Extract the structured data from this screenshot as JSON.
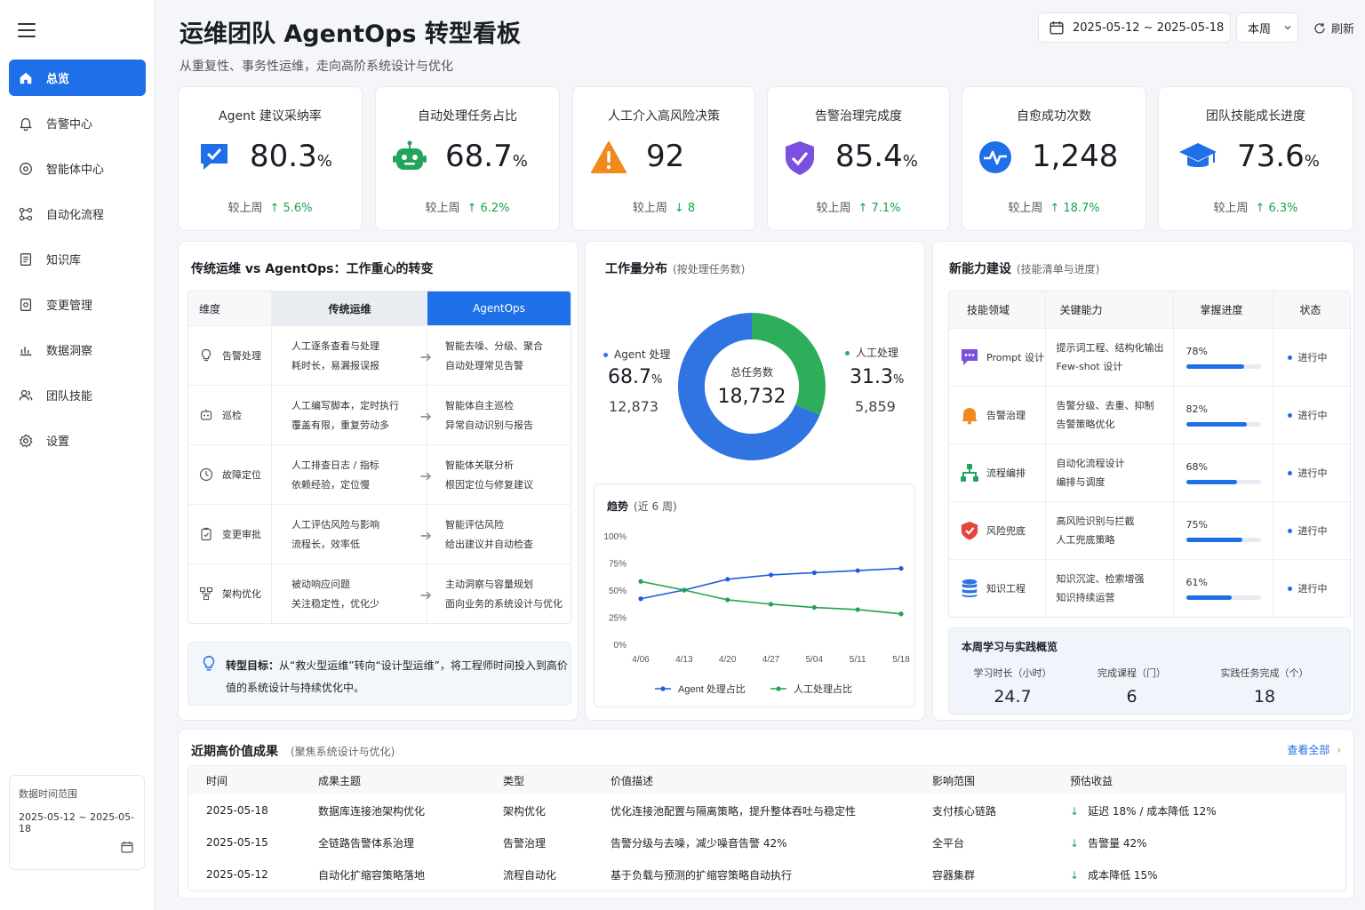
{
  "sidebar": {
    "items": [
      {
        "label": "总览",
        "icon": "home-icon"
      },
      {
        "label": "告警中心",
        "icon": "bell-icon"
      },
      {
        "label": "智能体中心",
        "icon": "agent-icon"
      },
      {
        "label": "自动化流程",
        "icon": "flow-icon"
      },
      {
        "label": "知识库",
        "icon": "book-icon"
      },
      {
        "label": "变更管理",
        "icon": "change-icon"
      },
      {
        "label": "数据洞察",
        "icon": "chart-icon"
      },
      {
        "label": "团队技能",
        "icon": "users-icon"
      },
      {
        "label": "设置",
        "icon": "gear-icon"
      }
    ],
    "date_range_label": "数据时间范围",
    "date_range": "2025-05-12 ~ 2025-05-18"
  },
  "header": {
    "title": "运维团队 AgentOps 转型看板",
    "subtitle": "从重复性、事务性运维，走向高阶系统设计与优化",
    "date_picker": "2025-05-12 ~ 2025-05-18",
    "period": "本周",
    "refresh": "刷新"
  },
  "kpis": [
    {
      "title": "Agent 建议采纳率",
      "value": "80.3",
      "unit": "%",
      "change_label": "较上周",
      "change": "5.6%",
      "dir": "up",
      "icon": "check-chat-icon",
      "color": "#1e6fe8"
    },
    {
      "title": "自动处理任务占比",
      "value": "68.7",
      "unit": "%",
      "change_label": "较上周",
      "change": "6.2%",
      "dir": "up",
      "icon": "robot-icon",
      "color": "#22a55a"
    },
    {
      "title": "人工介入高风险决策",
      "value": "92",
      "unit": "",
      "change_label": "较上周",
      "change": "8",
      "dir": "down",
      "icon": "warning-icon",
      "color": "#f08a1c"
    },
    {
      "title": "告警治理完成度",
      "value": "85.4",
      "unit": "%",
      "change_label": "较上周",
      "change": "7.1%",
      "dir": "up",
      "icon": "shield-check-icon",
      "color": "#7b4fe0"
    },
    {
      "title": "自愈成功次数",
      "value": "1,248",
      "unit": "",
      "change_label": "较上周",
      "change": "18.7%",
      "dir": "up",
      "icon": "pulse-icon",
      "color": "#1e6fe8"
    },
    {
      "title": "团队技能成长进度",
      "value": "73.6",
      "unit": "%",
      "change_label": "较上周",
      "change": "6.3%",
      "dir": "up",
      "icon": "graduation-cap-icon",
      "color": "#1e6fe8"
    }
  ],
  "compare": {
    "title": "传统运维 vs AgentOps：工作重心的转变",
    "headers": [
      "维度",
      "传统运维",
      "AgentOps"
    ],
    "rows": [
      {
        "dim": "告警处理",
        "icon": "bulb-icon",
        "trad": [
          "人工逐条查看与处理",
          "耗时长，易漏报误报"
        ],
        "agent": [
          "智能去噪、分级、聚合",
          "自动处理常见告警"
        ]
      },
      {
        "dim": "巡检",
        "icon": "robot-outline-icon",
        "trad": [
          "人工编写脚本，定时执行",
          "覆盖有限，重复劳动多"
        ],
        "agent": [
          "智能体自主巡检",
          "异常自动识别与报告"
        ]
      },
      {
        "dim": "故障定位",
        "icon": "clock-icon",
        "trad": [
          "人工排查日志 / 指标",
          "依赖经验，定位慢"
        ],
        "agent": [
          "智能体关联分析",
          "根因定位与修复建议"
        ]
      },
      {
        "dim": "变更审批",
        "icon": "clipboard-icon",
        "trad": [
          "人工评估风险与影响",
          "流程长，效率低"
        ],
        "agent": [
          "智能评估风险",
          "给出建议并自动检查"
        ]
      },
      {
        "dim": "架构优化",
        "icon": "architecture-icon",
        "trad": [
          "被动响应问题",
          "关注稳定性，优化少"
        ],
        "agent": [
          "主动洞察与容量规划",
          "面向业务的系统设计与优化"
        ]
      }
    ],
    "goal_label": "转型目标：",
    "goal_text": "从“救火型运维”转向“设计型运维”，将工程师时间投入到高价值的系统设计与持续优化中。"
  },
  "workload": {
    "title": "工作量分布",
    "subtitle": "(按处理任务数)",
    "center_label": "总任务数",
    "total": "18,732",
    "agent": {
      "label": "Agent 处理",
      "pct": "68.7",
      "pct_unit": "%",
      "count": "12,873",
      "color": "#2f74e0"
    },
    "human": {
      "label": "人工处理",
      "pct": "31.3",
      "pct_unit": "%",
      "count": "5,859",
      "color": "#2eae5a"
    },
    "trend_title": "趋势",
    "trend_sub": "(近 6 周)"
  },
  "chart_data": {
    "type": "line",
    "x": [
      "4/06",
      "4/13",
      "4/20",
      "4/27",
      "5/04",
      "5/11",
      "5/18"
    ],
    "yticks": [
      "100%",
      "75%",
      "50%",
      "25%",
      "0%"
    ],
    "ylim": [
      0,
      100
    ],
    "series": [
      {
        "name": "Agent 处理占比",
        "values": [
          42,
          50,
          60,
          64,
          66,
          68,
          70
        ],
        "color": "#1e5fd8"
      },
      {
        "name": "人工处理占比",
        "values": [
          58,
          50,
          41,
          37,
          34,
          32,
          28
        ],
        "color": "#23a24a"
      }
    ],
    "donut": [
      {
        "name": "Agent 处理",
        "value": 68.7
      },
      {
        "name": "人工处理",
        "value": 31.3
      }
    ]
  },
  "skills": {
    "title": "新能力建设",
    "subtitle": "(技能清单与进度)",
    "headers": [
      "技能领域",
      "关键能力",
      "掌握进度",
      "状态"
    ],
    "rows": [
      {
        "area": "Prompt 设计",
        "icon": "chat-bubble-icon",
        "color": "#7b4fe0",
        "cap": [
          "提示词工程、结构化输出",
          "Few-shot 设计"
        ],
        "progress": 78,
        "progress_label": "78%",
        "status": "进行中"
      },
      {
        "area": "告警治理",
        "icon": "bell-icon",
        "color": "#f08a1c",
        "cap": [
          "告警分级、去重、抑制",
          "告警策略优化"
        ],
        "progress": 82,
        "progress_label": "82%",
        "status": "进行中"
      },
      {
        "area": "流程编排",
        "icon": "flow-icon",
        "color": "#22a55a",
        "cap": [
          "自动化流程设计",
          "编排与调度"
        ],
        "progress": 68,
        "progress_label": "68%",
        "status": "进行中"
      },
      {
        "area": "风险兜底",
        "icon": "shield-check-icon",
        "color": "#e2453c",
        "cap": [
          "高风险识别与拦截",
          "人工兜底策略"
        ],
        "progress": 75,
        "progress_label": "75%",
        "status": "进行中"
      },
      {
        "area": "知识工程",
        "icon": "database-icon",
        "color": "#2f74e0",
        "cap": [
          "知识沉淀、检索增强",
          "知识持续运营"
        ],
        "progress": 61,
        "progress_label": "61%",
        "status": "进行中"
      }
    ],
    "learn_title": "本周学习与实践概览",
    "learn": [
      {
        "label": "学习时长（小时）",
        "value": "24.7"
      },
      {
        "label": "完成课程（门）",
        "value": "6"
      },
      {
        "label": "实践任务完成（个）",
        "value": "18"
      }
    ]
  },
  "results": {
    "title": "近期高价值成果",
    "subtitle": "(聚焦系统设计与优化)",
    "view_all": "查看全部",
    "headers": [
      "时间",
      "成果主题",
      "类型",
      "价值描述",
      "影响范围",
      "预估收益"
    ],
    "rows": [
      [
        "2025-05-18",
        "数据库连接池架构优化",
        "架构优化",
        "优化连接池配置与隔离策略，提升整体吞吐与稳定性",
        "支付核心链路",
        "延迟 18% / 成本降低 12%"
      ],
      [
        "2025-05-15",
        "全链路告警体系治理",
        "告警治理",
        "告警分级与去噪，减少噪音告警 42%",
        "全平台",
        "告警量 42%"
      ],
      [
        "2025-05-12",
        "自动化扩缩容策略落地",
        "流程自动化",
        "基于负载与预测的扩缩容策略自动执行",
        "容器集群",
        "成本降低 15%"
      ]
    ]
  }
}
